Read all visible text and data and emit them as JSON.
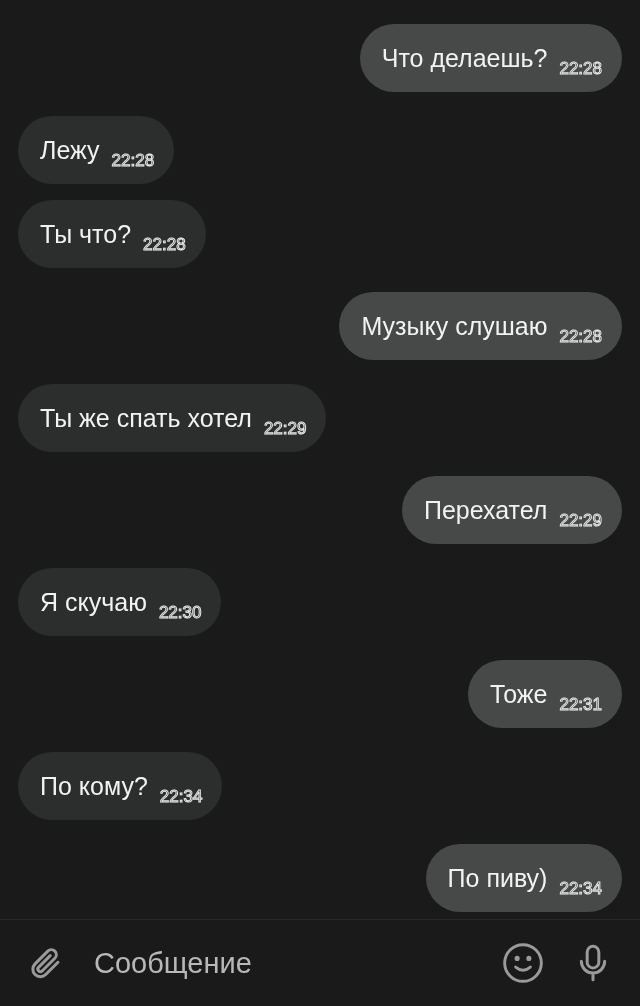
{
  "messages": [
    {
      "kind": "sent",
      "text": "Что делаешь?",
      "time": "22:28"
    },
    {
      "kind": "received",
      "text": "Лежу",
      "time": "22:28"
    },
    {
      "kind": "received",
      "text": "Ты что?",
      "time": "22:28"
    },
    {
      "kind": "sent",
      "text": "Музыку слушаю",
      "time": "22:28"
    },
    {
      "kind": "received",
      "text": "Ты же спать хотел",
      "time": "22:29"
    },
    {
      "kind": "sent",
      "text": "Перехател",
      "time": "22:29"
    },
    {
      "kind": "received",
      "text": "Я скучаю",
      "time": "22:30"
    },
    {
      "kind": "sent",
      "text": "Тоже",
      "time": "22:31"
    },
    {
      "kind": "received",
      "text": "По кому?",
      "time": "22:34"
    },
    {
      "kind": "sent",
      "text": "По пиву)",
      "time": "22:34"
    }
  ],
  "composer": {
    "placeholder": "Сообщение"
  }
}
